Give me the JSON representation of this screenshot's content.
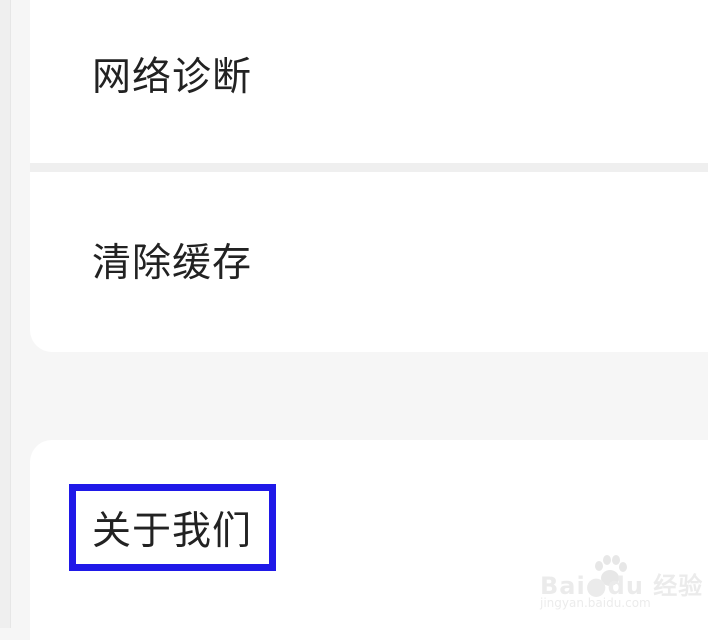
{
  "settings": {
    "items": [
      {
        "label": "网络诊断"
      },
      {
        "label": "清除缓存"
      },
      {
        "label": "关于我们"
      }
    ]
  },
  "watermark": {
    "brand": "Bai●du 经验",
    "url": "jingyan.baidu.com"
  },
  "colors": {
    "background": "#f6f6f6",
    "card": "#ffffff",
    "divider": "#efefef",
    "text": "#222222",
    "highlight": "#1f19e8"
  }
}
